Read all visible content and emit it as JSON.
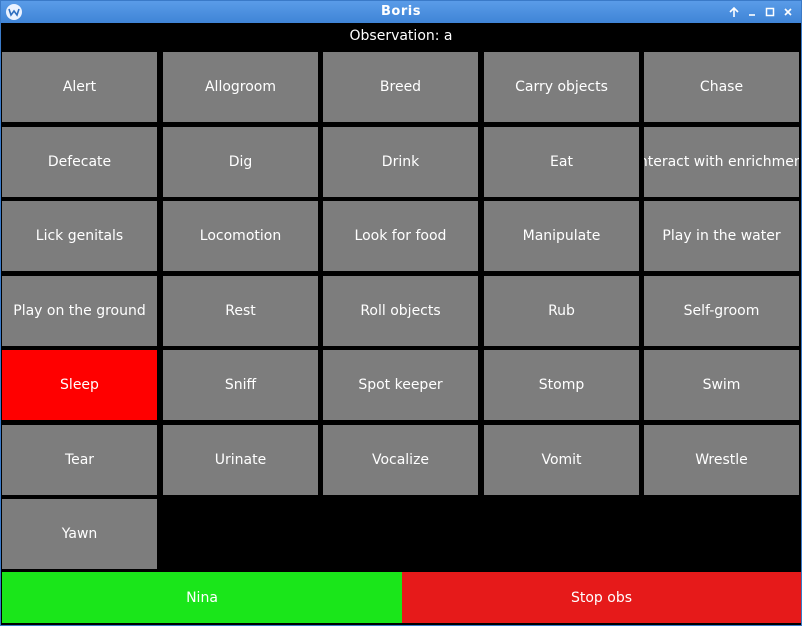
{
  "window": {
    "title": "Boris",
    "titlebar_color": "#4a8fde",
    "controls": [
      "keep-above",
      "minimize",
      "maximize",
      "close"
    ]
  },
  "observation": {
    "label": "Observation: a"
  },
  "behaviors": [
    {
      "label": "Alert"
    },
    {
      "label": "Allogroom"
    },
    {
      "label": "Breed"
    },
    {
      "label": "Carry objects"
    },
    {
      "label": "Chase"
    },
    {
      "label": "Defecate"
    },
    {
      "label": "Dig"
    },
    {
      "label": "Drink"
    },
    {
      "label": "Eat"
    },
    {
      "label": "Interact with enrichment"
    },
    {
      "label": "Lick genitals"
    },
    {
      "label": "Locomotion"
    },
    {
      "label": "Look for food"
    },
    {
      "label": "Manipulate"
    },
    {
      "label": "Play in the water"
    },
    {
      "label": "Play on the ground"
    },
    {
      "label": "Rest"
    },
    {
      "label": "Roll objects"
    },
    {
      "label": "Rub"
    },
    {
      "label": "Self-groom"
    },
    {
      "label": "Sleep",
      "active": true
    },
    {
      "label": "Sniff"
    },
    {
      "label": "Spot keeper"
    },
    {
      "label": "Stomp"
    },
    {
      "label": "Swim"
    },
    {
      "label": "Tear"
    },
    {
      "label": "Urinate"
    },
    {
      "label": "Vocalize"
    },
    {
      "label": "Vomit"
    },
    {
      "label": "Wrestle"
    },
    {
      "label": "Yawn"
    }
  ],
  "colors": {
    "behavior_default": "#7d7d7d",
    "behavior_active": "#ff0000",
    "subject_button": "#1ae61a",
    "stop_button": "#e61a1a"
  },
  "subject": {
    "label": "Nina"
  },
  "stop": {
    "label": "Stop obs"
  }
}
